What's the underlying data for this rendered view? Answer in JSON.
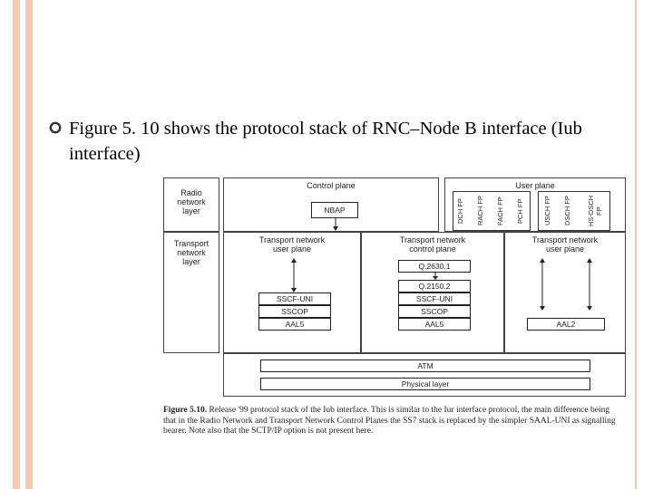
{
  "bullet": {
    "text": "Figure 5. 10 shows the protocol stack of RNC–Node B interface (Iub interface)"
  },
  "diagram": {
    "row_labels": {
      "radio_network_layer": "Radio\nnetwork\nlayer",
      "transport_network_layer": "Transport\nnetwork\nlayer"
    },
    "top_headers": {
      "control_plane": "Control plane",
      "user_plane": "User plane"
    },
    "mid_headers": {
      "tn_user_plane_left": "Transport network\nuser plane",
      "tn_control_plane": "Transport network\ncontrol plane",
      "tn_user_plane_right": "Transport network\nuser plane"
    },
    "user_plane_cols": [
      "DCH FP",
      "RACH FP",
      "FACH FP",
      "PCH FP",
      "USCH FP",
      "DSCH FP",
      "HS-DSCH FP"
    ],
    "control_box": "NBAP",
    "cp_stack": [
      "SSCF-UNI",
      "SSCOP",
      "AAL5"
    ],
    "tn_cp_stack": [
      "Q.2630.1",
      "Q.2150.2",
      "SSCF-UNI",
      "SSCOP",
      "AAL5"
    ],
    "up_stack": [
      "AAL2"
    ],
    "bottom_bars": {
      "atm": "ATM",
      "phys": "Physical layer"
    }
  },
  "caption": {
    "lead": "Figure 5.10.",
    "rest": " Release '99 protocol stack of the Iub interface. This is similar to the Iur interface protocol, the main difference being that in the Radio Network and Transport Network Control Planes the SS7 stack is replaced by the simpler SAAL-UNI as signalling bearer. Note also that the SCTP/IP option is not present here."
  }
}
